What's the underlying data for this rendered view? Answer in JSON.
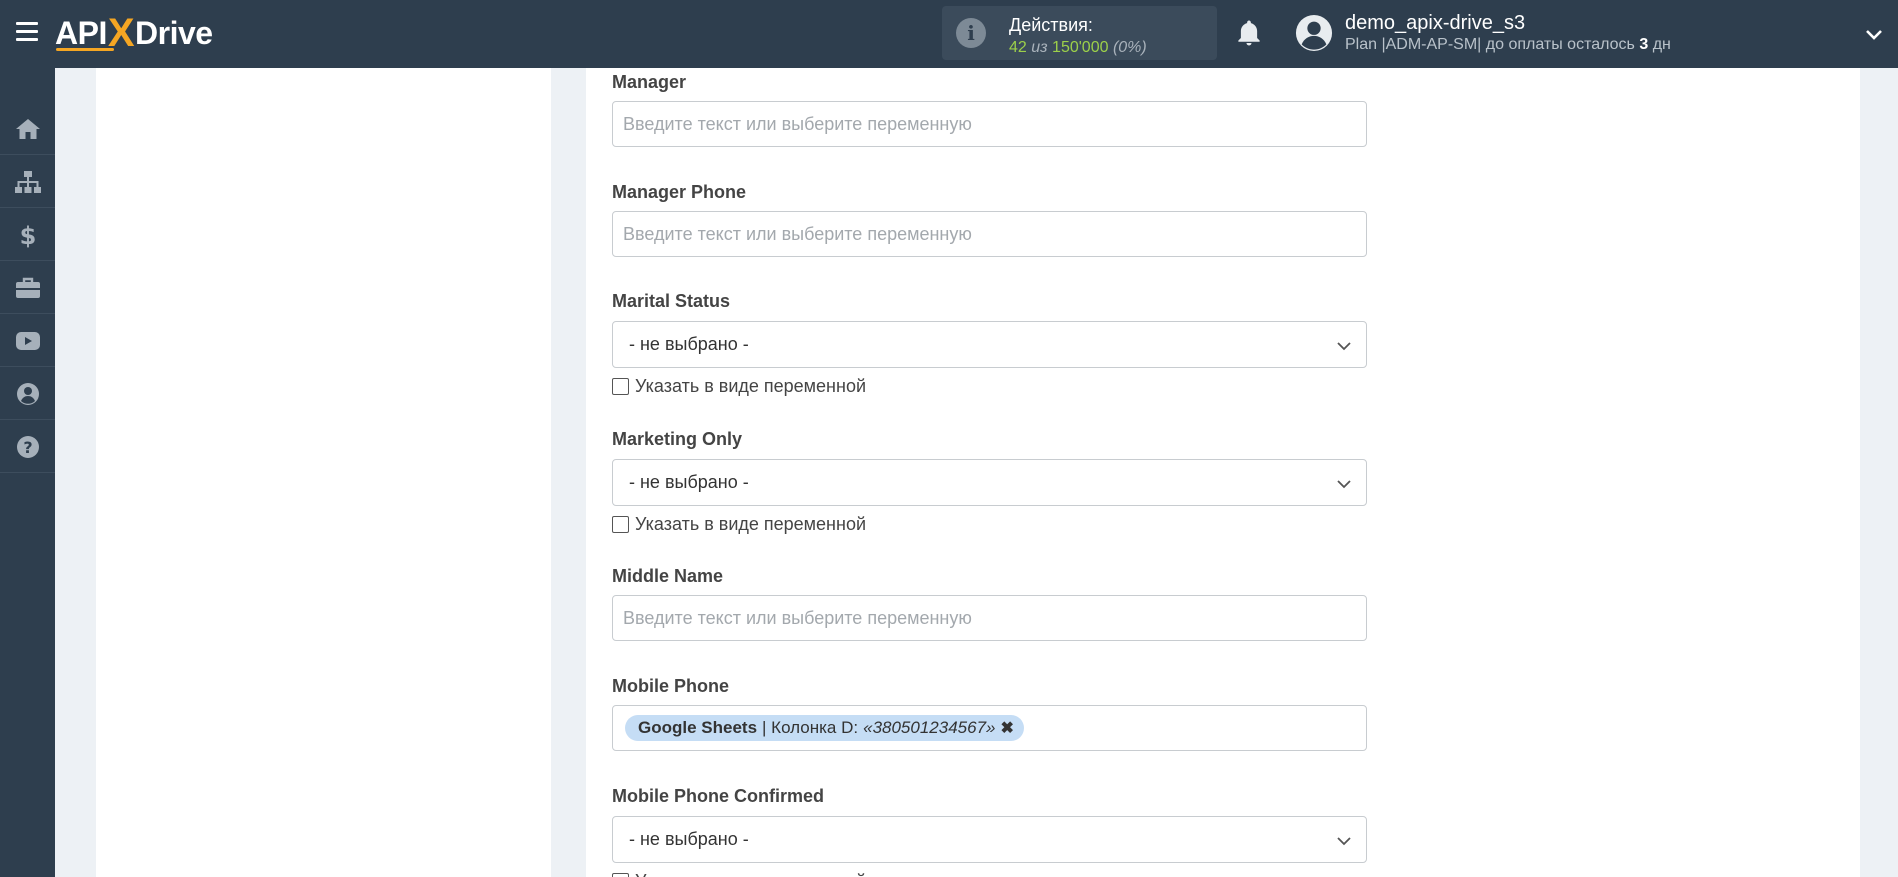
{
  "app": {
    "logo_left": "API",
    "logo_x": "X",
    "logo_right": "Drive"
  },
  "actions": {
    "title": "Действия:",
    "used": "42",
    "of_word": "из",
    "total": "150'000",
    "percent": "(0%)"
  },
  "user": {
    "name": "demo_apix-drive_s3",
    "plan_prefix": "Plan |ADM-AP-SM| до оплаты осталось",
    "days": "3",
    "days_unit": "дн"
  },
  "sidebar": {
    "items": [
      {
        "icon": "home-icon"
      },
      {
        "icon": "sitemap-icon"
      },
      {
        "icon": "dollar-icon"
      },
      {
        "icon": "briefcase-icon"
      },
      {
        "icon": "youtube-icon"
      },
      {
        "icon": "user-circle-icon"
      },
      {
        "icon": "question-circle-icon"
      }
    ]
  },
  "form": {
    "placeholder": "Введите текст или выберите переменную",
    "not_selected": "- не выбрано -",
    "as_variable": "Указать в виде переменной",
    "fields": {
      "manager": {
        "label": "Manager"
      },
      "manager_phone": {
        "label": "Manager Phone"
      },
      "marital_status": {
        "label": "Marital Status"
      },
      "marketing_only": {
        "label": "Marketing Only"
      },
      "middle_name": {
        "label": "Middle Name"
      },
      "mobile_phone": {
        "label": "Mobile Phone",
        "tag_source": "Google Sheets",
        "tag_column": "| Колонка D:",
        "tag_value": "«380501234567»",
        "tag_remove": "✖"
      },
      "mobile_phone_confirmed": {
        "label": "Mobile Phone Confirmed"
      }
    }
  }
}
